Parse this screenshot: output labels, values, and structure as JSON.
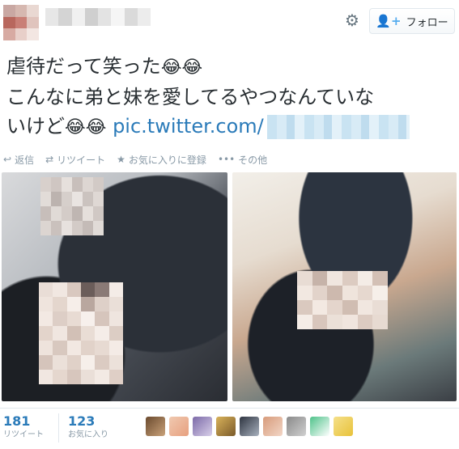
{
  "header": {
    "follow_label": "フォロー",
    "follow_icon": "add-user-icon",
    "settings_icon": "gear-icon"
  },
  "tweet": {
    "line1": "虐待だって笑った",
    "line2": "こんなに弟と妹を愛してるやつなんていな",
    "line3_prefix": "いけど",
    "link_text": "pic.twitter.com/",
    "emoji": "😂😂"
  },
  "actions": [
    {
      "icon": "reply-icon",
      "label": "返信"
    },
    {
      "icon": "retweet-icon",
      "label": "リツイート"
    },
    {
      "icon": "star-icon",
      "label": "お気に入りに登録"
    },
    {
      "icon": "more-icon",
      "label": "その他"
    }
  ],
  "stats": {
    "retweets": {
      "value": "181",
      "label": "リツイート"
    },
    "favorites": {
      "value": "123",
      "label": "お気に入り"
    }
  },
  "colors": {
    "link": "#2b7bb9",
    "text": "#292f33",
    "muted": "#8899a6"
  }
}
